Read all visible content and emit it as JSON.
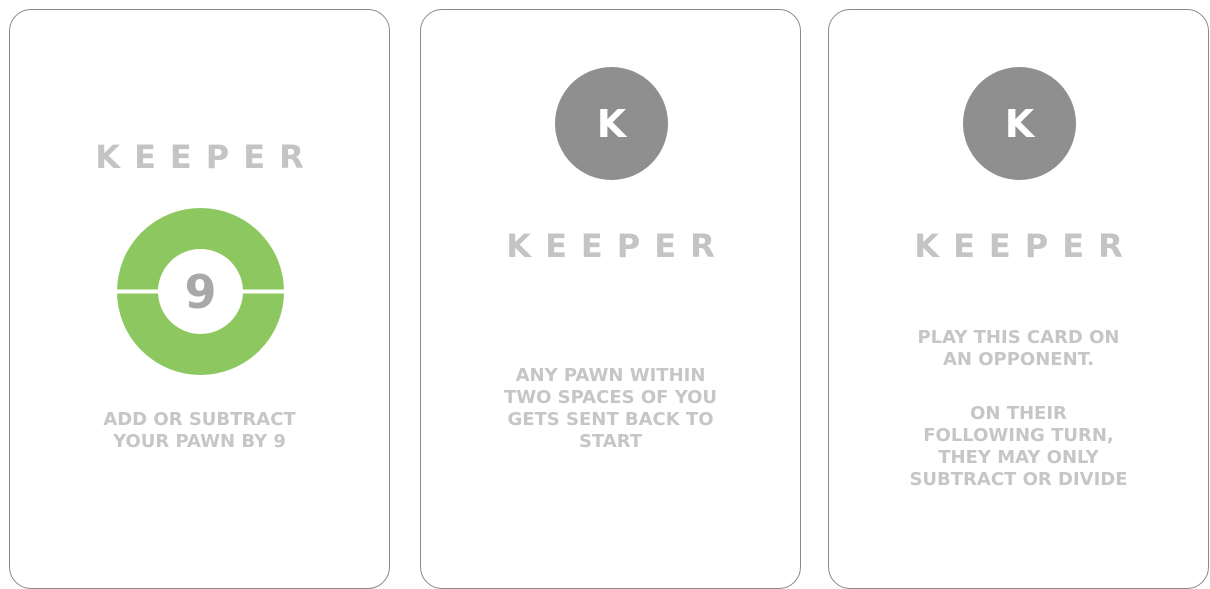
{
  "colors": {
    "card_border": "#8a8a8a",
    "title_text": "#c4c4c4",
    "body_text": "#c6c6c6",
    "ring_green": "#8cc85f",
    "badge_grey": "#8f8f8f",
    "number_grey": "#a8a8a8"
  },
  "cards": [
    {
      "title": "KEEPER",
      "icon": "green-ring",
      "number": "9",
      "text": "ADD OR SUBTRACT\nYOUR PAWN BY 9"
    },
    {
      "badge": "K",
      "icon": "k-circle",
      "title": "KEEPER",
      "text": "ANY PAWN WITHIN\nTWO SPACES OF YOU\nGETS SENT BACK TO\nSTART"
    },
    {
      "badge": "K",
      "icon": "k-circle",
      "title": "KEEPER",
      "text_1": "PLAY THIS CARD ON\nAN OPPONENT.",
      "text_2": "ON THEIR\nFOLLOWING TURN,\nTHEY MAY ONLY\nSUBTRACT OR DIVIDE"
    }
  ]
}
